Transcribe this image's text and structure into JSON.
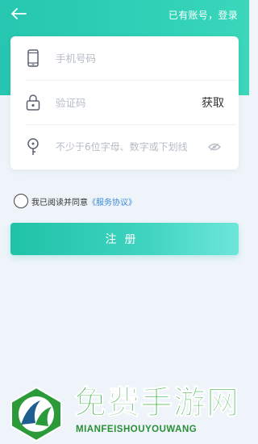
{
  "header": {
    "back_icon": "arrow-left-icon",
    "login_link": "已有账号，登录"
  },
  "form": {
    "phone": {
      "icon": "phone-icon",
      "placeholder": "手机号码"
    },
    "code": {
      "icon": "lock-icon",
      "placeholder": "验证码",
      "get_code_label": "获取"
    },
    "password": {
      "icon": "key-icon",
      "placeholder": "不少于6位字母、数字或下划线",
      "eye_icon": "eye-off-icon"
    }
  },
  "agreement": {
    "text": "我已阅读并同意",
    "link": "《服务协议》"
  },
  "submit_label": "注册",
  "watermark": {
    "title": "免费手游网",
    "subtitle": "MIANFEISHOUYOUWANG"
  },
  "colors": {
    "accent": "#2fd0b6",
    "link": "#3a8bd8",
    "placeholder": "#b5bcc6"
  }
}
